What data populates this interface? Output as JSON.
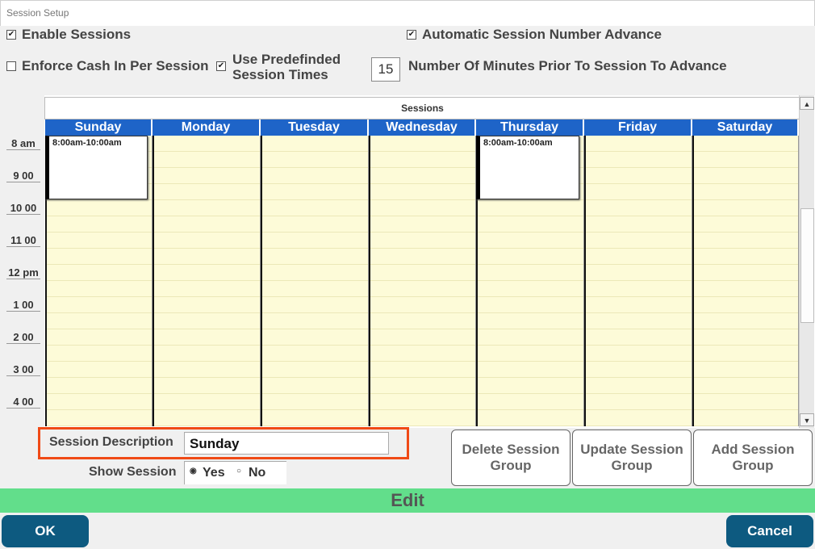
{
  "window": {
    "title": "Session Setup"
  },
  "options": {
    "enable_sessions": {
      "label": "Enable Sessions",
      "checked": true
    },
    "auto_advance": {
      "label": "Automatic Session Number Advance",
      "checked": true
    },
    "enforce_cash": {
      "label": "Enforce Cash In Per Session",
      "checked": false
    },
    "predefined": {
      "label_line1": "Use Predefinded",
      "label_line2": "Session Times",
      "checked": true
    },
    "minutes_value": "15",
    "minutes_label": "Number Of Minutes Prior To Session To Advance"
  },
  "calendar": {
    "header": "Sessions",
    "days": [
      "Sunday",
      "Monday",
      "Tuesday",
      "Wednesday",
      "Thursday",
      "Friday",
      "Saturday"
    ],
    "times": [
      "8 am",
      "9 00",
      "10 00",
      "11 00",
      "12 pm",
      "1 00",
      "2 00",
      "3 00",
      "4 00"
    ],
    "appointments": [
      {
        "day": "Sunday",
        "text": "8:00am-10:00am"
      },
      {
        "day": "Thursday",
        "text": "8:00am-10:00am"
      }
    ]
  },
  "form": {
    "desc_label": "Session Description",
    "desc_value": "Sunday",
    "show_label": "Show Session",
    "yes": "Yes",
    "no": "No"
  },
  "buttons": {
    "delete_line1": "Delete Session",
    "delete_line2": "Group",
    "update_line1": "Update Session",
    "update_line2": "Group",
    "add_line1": "Add Session",
    "add_line2": "Group",
    "mode": "Edit",
    "ok": "OK",
    "cancel": "Cancel"
  },
  "colors": {
    "day_header": "#1e64c8",
    "highlight": "#f04a16",
    "edit_bar": "#62de8b",
    "primary_button": "#0d5a80"
  }
}
